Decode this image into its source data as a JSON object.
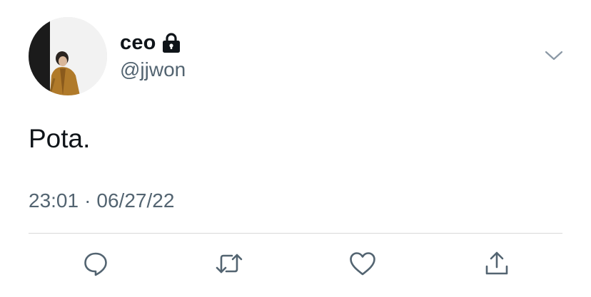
{
  "user": {
    "display_name": "ceo",
    "handle": "@jjwon",
    "protected": true,
    "avatar": "person-in-mustard-jacket"
  },
  "tweet": {
    "text": "Pota.",
    "time": "23:01",
    "separator": "·",
    "date": "06/27/22"
  },
  "actions": {
    "reply": "reply-icon",
    "retweet": "retweet-icon",
    "like": "like-icon",
    "share": "share-icon"
  },
  "colors": {
    "text": "#0f1419",
    "secondary": "#536471",
    "divider": "#d9d9d9",
    "icon": "#536471"
  }
}
